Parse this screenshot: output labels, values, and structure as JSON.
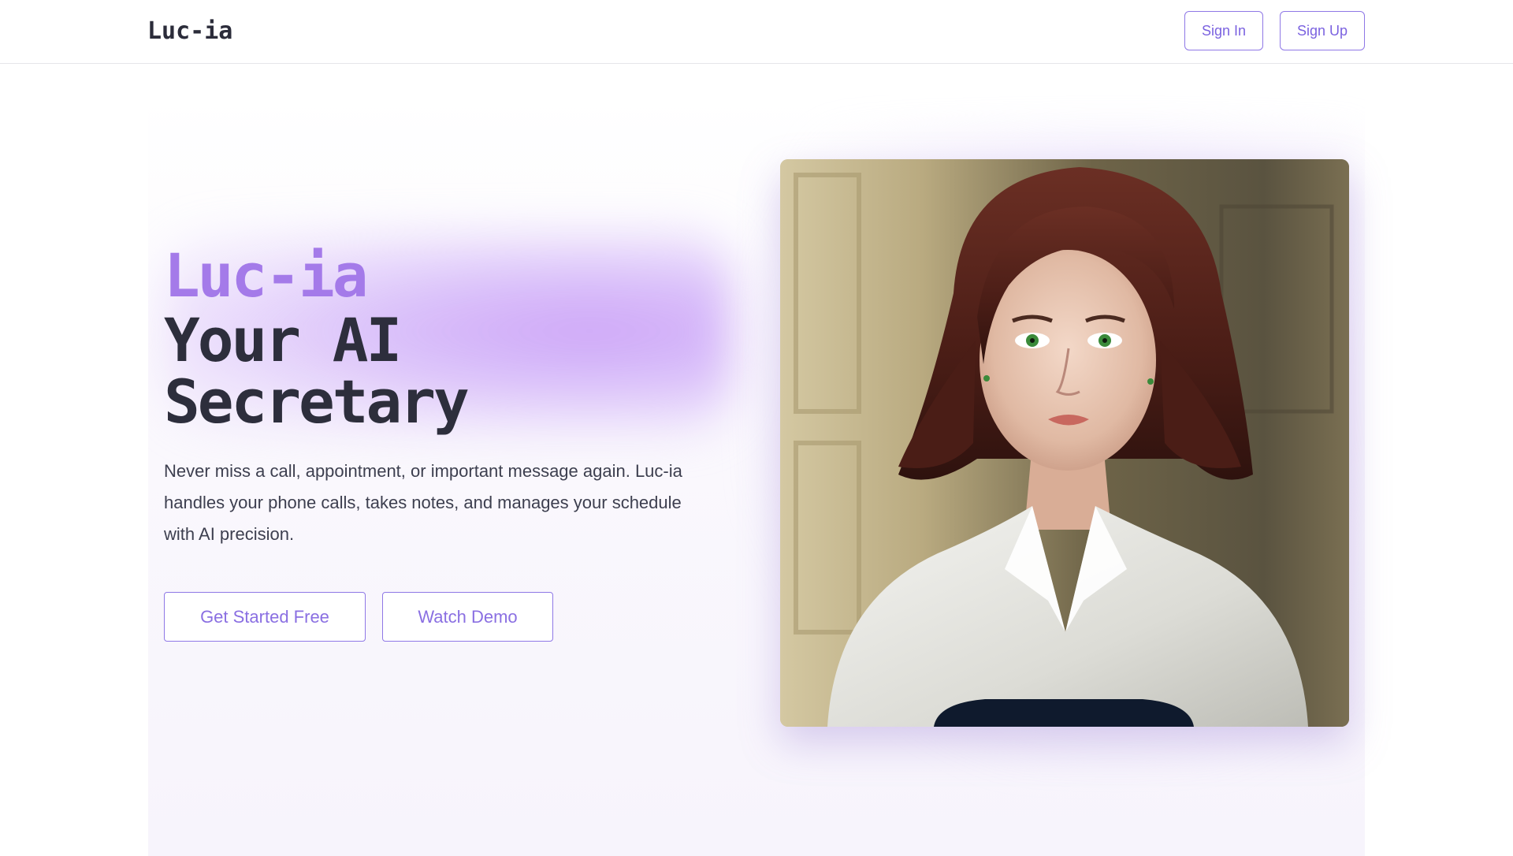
{
  "header": {
    "logo": "Luc-ia",
    "sign_in_label": "Sign In",
    "sign_up_label": "Sign Up"
  },
  "hero": {
    "brand": "Luc-ia",
    "title_line1": "Your AI",
    "title_line2": "Secretary",
    "description": "Never miss a call, appointment, or important message again. Luc-ia handles your phone calls, takes notes, and manages your schedule with AI precision.",
    "primary_cta": "Get Started Free",
    "secondary_cta": "Watch Demo"
  },
  "colors": {
    "accent": "#8a6fe2",
    "brand_purple": "#a47ae9",
    "heading": "#2d2e3c"
  }
}
